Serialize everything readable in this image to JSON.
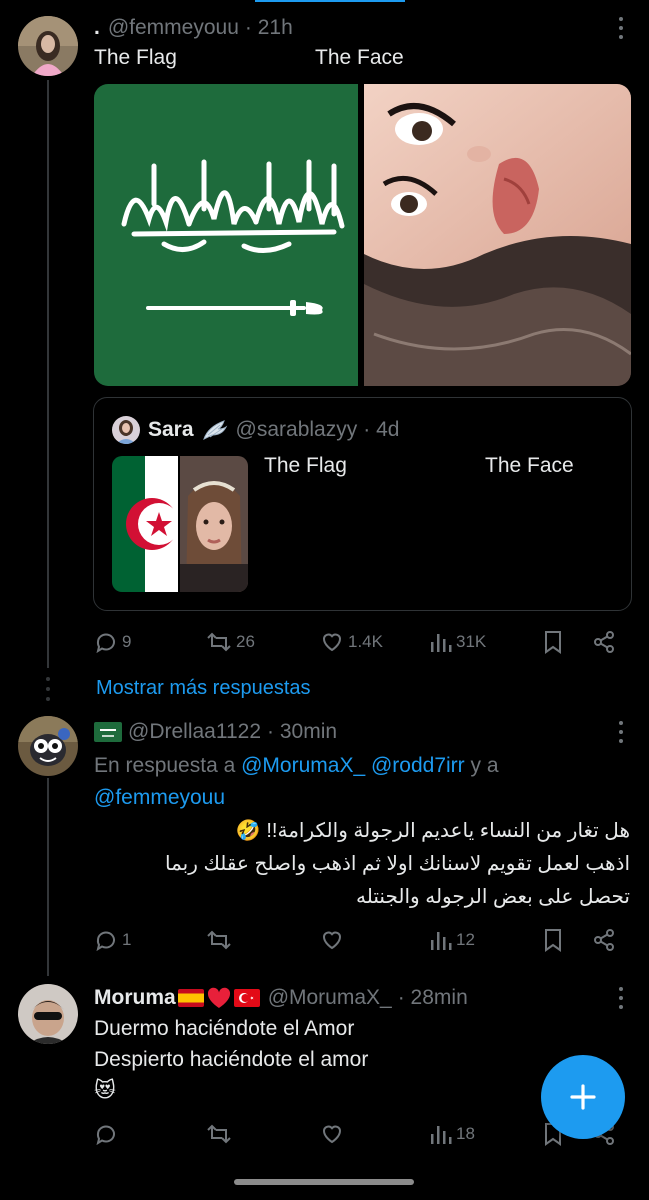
{
  "tweet1": {
    "dot": ".",
    "handle": "@femmeyouu",
    "time": "· 21h",
    "text_left": "The Flag",
    "text_right": "The Face",
    "image_left": "saudi-flag-image",
    "image_right": "face-photo",
    "quote": {
      "name": "Sara",
      "name_icon": "wing-emoji",
      "handle": "@sarablazyy",
      "time": "· 4d",
      "text_left": "The Flag",
      "text_right": "The Face",
      "image_left": "algeria-flag-image",
      "image_right": "face-photo"
    },
    "actions": {
      "replies": "9",
      "reposts": "26",
      "likes": "1.4K",
      "views": "31K"
    }
  },
  "show_more": "Mostrar más respuestas",
  "tweet2": {
    "flag_icon": "saudi-flag-emoji",
    "handle": "@Drellaa1122",
    "time": "· 30min",
    "reply_prefix": "En respuesta a",
    "mention1": "@MorumaX_",
    "mention2": "@rodd7irr",
    "reply_and": "y a",
    "mention3": "@femmeyouu",
    "line1": "هل تغار من النساء ياعديم الرجولة والكرامة!!",
    "line2": "اذهب لعمل تقويم لاسنانك اولا ثم اذهب واصلح عقلك ربما",
    "line3": "تحصل على بعض الرجوله والجنتله",
    "emoji": "🤣",
    "actions": {
      "replies": "1",
      "reposts": "",
      "likes": "",
      "views": "12"
    }
  },
  "tweet3": {
    "name": "Moruma",
    "name_flags": [
      "spain-flag-emoji",
      "red-heart-emoji",
      "turkey-flag-emoji"
    ],
    "handle": "@MorumaX_",
    "time": "· 28min",
    "line1": "Duermo haciéndote el Amor",
    "line2": "Despierto haciéndote el amor",
    "emoji": "😻",
    "actions": {
      "replies": "",
      "reposts": "",
      "likes": "",
      "views": "18"
    }
  },
  "colors": {
    "accent": "#1d9bf0",
    "muted": "#71767b",
    "text": "#e7e9ea",
    "background": "#000000",
    "border": "#2f3336"
  }
}
